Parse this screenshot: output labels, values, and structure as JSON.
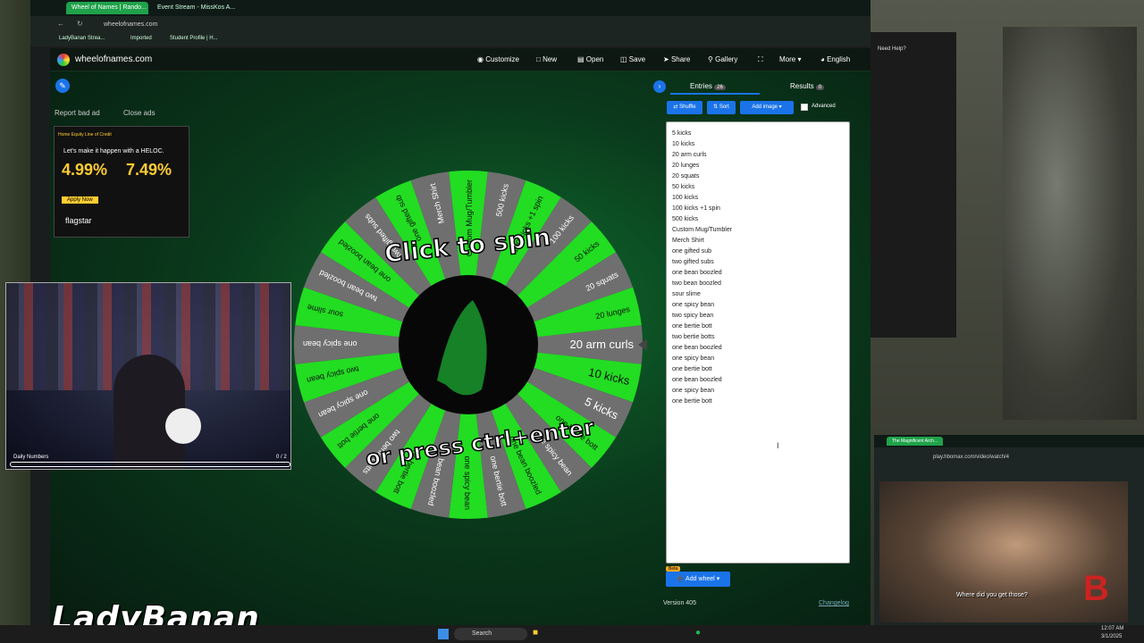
{
  "browser": {
    "tabs": [
      "Wheel of Names | Rando...",
      "Event Stream - MissKos A..."
    ],
    "address": "wheelofnames.com",
    "bookmarks": [
      "LadyBanan Strea...",
      "Imported",
      "Student Profile | H..."
    ]
  },
  "nav": {
    "logo": "wheelofnames.com",
    "customize": "Customize",
    "new": "New",
    "open": "Open",
    "save": "Save",
    "share": "Share",
    "gallery": "Gallery",
    "more": "More",
    "language": "English"
  },
  "ad": {
    "report": "Report bad ad",
    "close": "Close ads",
    "banner_top": "Home Equity Line of Credit",
    "banner_text": "Let's make it happen with a HELOC.",
    "rate1": "4.99%",
    "rate2": "7.49%",
    "button": "Apply Now",
    "brand": "flagstar"
  },
  "wheel": {
    "title_top": "Click to spin",
    "title_bottom": "or press ctrl+enter",
    "slices": [
      "20 arm curls",
      "10 kicks",
      "5 kicks",
      "one bertie bott",
      "one spicy bean",
      "one bean boozled",
      "one bertie bott",
      "one spicy bean",
      "one bean boozled",
      "one bertie bott",
      "two bertie botts",
      "one bertie bott",
      "one spicy bean",
      "two spicy bean",
      "one spicy bean",
      "sour slime",
      "two bean boozled",
      "one bean boozled",
      "two gifted subs",
      "one gifted sub",
      "Merch Shirt",
      "Custom Mug/Tumbler",
      "500 kicks",
      "100 kicks +1 spin",
      "100 kicks",
      "50 kicks",
      "20 squats",
      "20 lunges"
    ]
  },
  "panel": {
    "tab_entries": "Entries",
    "entries_count": "26",
    "tab_results": "Results",
    "results_count": "0",
    "shuffle": "Shuffle",
    "sort": "Sort",
    "add_image": "Add image",
    "advanced": "Advanced",
    "entries": [
      "5 kicks",
      "10 kicks",
      "20 arm curls",
      "20 lunges",
      "20 squats",
      "50 kicks",
      "100 kicks",
      "100 kicks +1 spin",
      "500 kicks",
      "Custom Mug/Tumbler",
      "Merch Shirt",
      "one gifted sub",
      "two gifted subs",
      "one bean boozled",
      "two bean boozled",
      "sour slime",
      "one spicy bean",
      "two spicy bean",
      "one bertie bott",
      "two bertie botts",
      "one bean boozled",
      "one spicy bean",
      "one bertie bott",
      "one bean boozled",
      "one spicy bean",
      "one bertie bott"
    ],
    "beta": "Beta",
    "add_wheel": "Add wheel",
    "version": "Version 405",
    "changelog": "Changelog"
  },
  "overlay": {
    "daily_label": "Daily Numbers",
    "daily_count": "0 / 2",
    "streamer": "LadyBanan__",
    "need_help": "Need Help?",
    "video_tab": "The Magnificent Arch...",
    "video_url": "play.hbomax.com/video/watch/4",
    "subtitle": "Where did you get those?"
  },
  "taskbar": {
    "search": "Search",
    "time": "12:07 AM",
    "date": "3/1/2025"
  },
  "colors": {
    "green": "#22dd22",
    "gray": "#6f6f6f",
    "accent": "#1a73e8"
  }
}
